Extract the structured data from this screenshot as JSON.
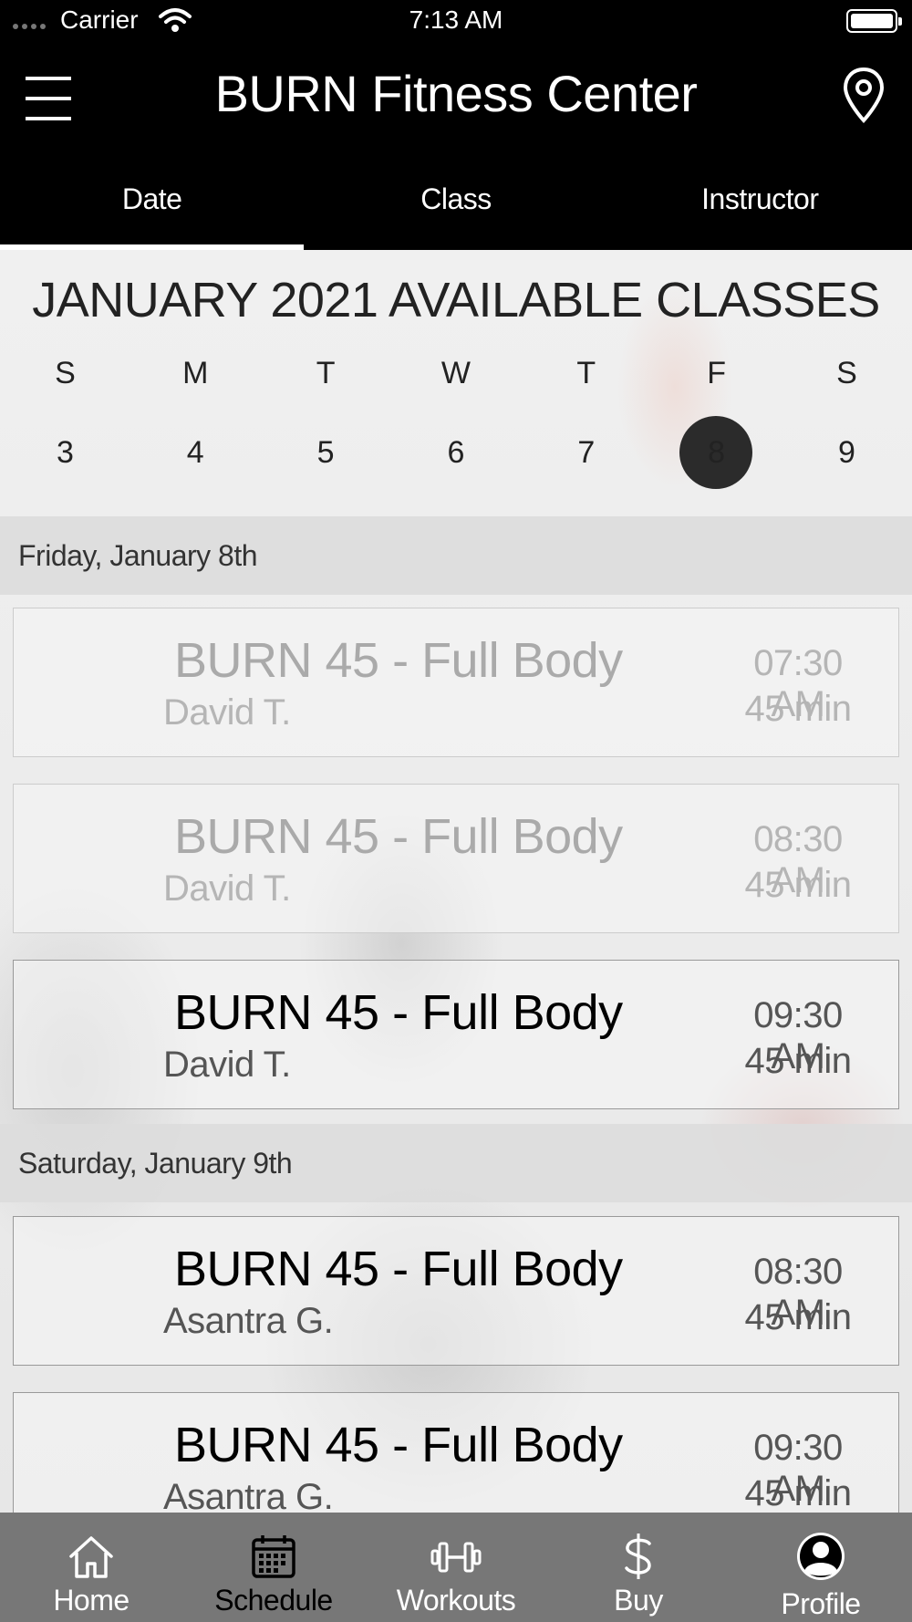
{
  "status_bar": {
    "carrier": "Carrier",
    "time": "7:13 AM"
  },
  "header": {
    "title": "BURN Fitness Center"
  },
  "tabs": [
    {
      "label": "Date",
      "active": true
    },
    {
      "label": "Class",
      "active": false
    },
    {
      "label": "Instructor",
      "active": false
    }
  ],
  "calendar": {
    "title": "JANUARY 2021 AVAILABLE CLASSES",
    "weekdays": [
      "S",
      "M",
      "T",
      "W",
      "T",
      "F",
      "S"
    ],
    "days": [
      "3",
      "4",
      "5",
      "6",
      "7",
      "8",
      "9"
    ],
    "selected_day": "8"
  },
  "sections": [
    {
      "date": "Friday, January 8th",
      "classes": [
        {
          "name": "BURN 45 - Full Body",
          "instructor": "David T.",
          "time": "07:30 AM",
          "duration": "45 min",
          "past": true
        },
        {
          "name": "BURN 45 - Full Body",
          "instructor": "David T.",
          "time": "08:30 AM",
          "duration": "45 min",
          "past": true
        },
        {
          "name": "BURN 45 - Full Body",
          "instructor": "David T.",
          "time": "09:30 AM",
          "duration": "45 min",
          "past": false
        }
      ]
    },
    {
      "date": "Saturday, January 9th",
      "classes": [
        {
          "name": "BURN 45 - Full Body",
          "instructor": "Asantra G.",
          "time": "08:30 AM",
          "duration": "45 min",
          "past": false
        },
        {
          "name": "BURN 45 - Full Body",
          "instructor": "Asantra G.",
          "time": "09:30 AM",
          "duration": "45 min",
          "past": false
        }
      ]
    }
  ],
  "bottom_nav": [
    {
      "label": "Home",
      "icon": "home-icon",
      "active": false
    },
    {
      "label": "Schedule",
      "icon": "calendar-icon",
      "active": true
    },
    {
      "label": "Workouts",
      "icon": "dumbbell-icon",
      "active": false
    },
    {
      "label": "Buy",
      "icon": "dollar-icon",
      "active": false
    },
    {
      "label": "Profile",
      "icon": "profile-icon",
      "active": false
    }
  ]
}
